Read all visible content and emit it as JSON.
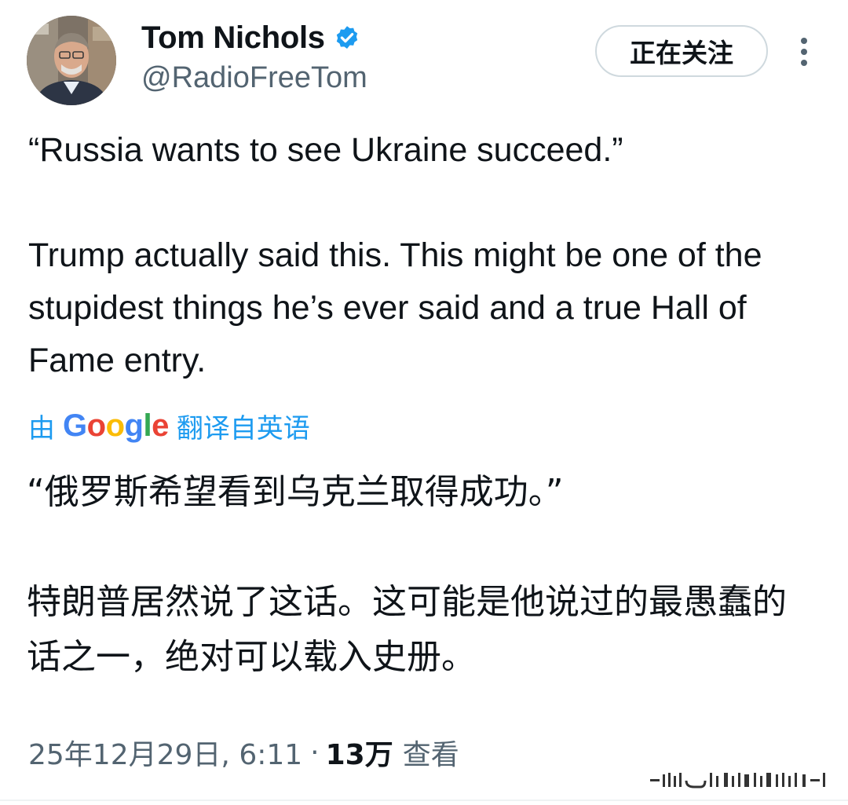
{
  "author": {
    "display_name": "Tom Nichols",
    "handle": "@RadioFreeTom",
    "verified_icon": "verified-badge-icon",
    "verified_color": "#1d9bf0"
  },
  "follow_button": {
    "label": "正在关注"
  },
  "more_button": {
    "icon": "more-vertical-icon"
  },
  "tweet": {
    "quote": "“Russia wants to see Ukraine succeed.”",
    "body": "Trump actually said this. This might be one of the stupidest things he’s ever said and a true Hall of Fame entry."
  },
  "translation": {
    "prefix": "由",
    "provider": "Google",
    "suffix": "翻译自英语",
    "quote": "“俄罗斯希望看到乌克兰取得成功。”",
    "body": "特朗普居然说了这话。这可能是他说过的最愚蠢的话之一，绝对可以载入史册。",
    "link_color": "#1d9bf0"
  },
  "meta": {
    "timestamp": "25年12月29日, 6:11",
    "separator": "·",
    "views_count": "13万",
    "views_label": "查看"
  },
  "watermark_icon": "watermark-glyph"
}
